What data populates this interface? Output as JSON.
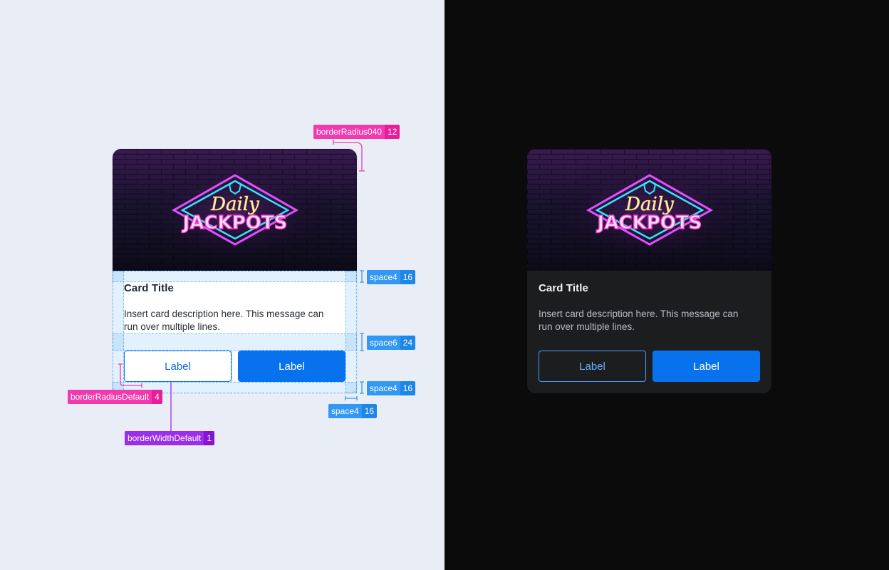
{
  "light_card": {
    "title": "Card Title",
    "description": "Insert card description here. This message can run over multiple lines.",
    "secondary_label": "Label",
    "primary_label": "Label",
    "hero_logo_line1": "Daily",
    "hero_logo_line2": "JACKPOTS"
  },
  "dark_card": {
    "title": "Card Title",
    "description": "Insert card description here. This message can run over multiple lines.",
    "secondary_label": "Label",
    "primary_label": "Label",
    "hero_logo_line1": "Daily",
    "hero_logo_line2": "JACKPOTS"
  },
  "spec_tags": {
    "border_radius_040": {
      "name": "borderRadius040",
      "value": "12"
    },
    "space4_top": {
      "name": "space4",
      "value": "16"
    },
    "space6": {
      "name": "space6",
      "value": "24"
    },
    "space4_bottom": {
      "name": "space4",
      "value": "16"
    },
    "space4_side": {
      "name": "space4",
      "value": "16"
    },
    "border_radius_default": {
      "name": "borderRadiusDefault",
      "value": "4"
    },
    "border_width_default": {
      "name": "borderWidthDefault",
      "value": "1"
    }
  },
  "colors": {
    "light_bg": "#e9eef6",
    "dark_bg": "#0b0b0c",
    "primary": "#0872ee",
    "tag_pink": "#f23aaf",
    "tag_blue": "#3298f2",
    "tag_purple": "#9b2ee8"
  }
}
